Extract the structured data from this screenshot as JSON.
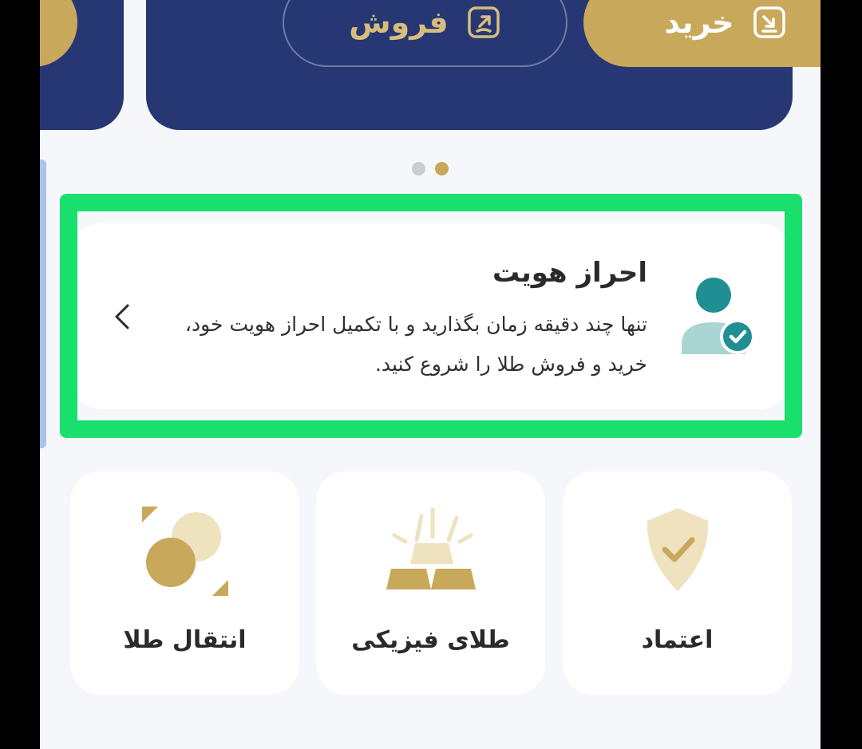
{
  "hero": {
    "buy_label": "خرید",
    "sell_label": "فروش",
    "navy_color": "#263773",
    "gold_color": "#c8a85a"
  },
  "carousel": {
    "active_index": 1,
    "count": 2
  },
  "kyc": {
    "title": "احراز هویت",
    "description": "تنها چند دقیقه زمان بگذارید و با تکمیل احراز هویت خود، خرید و فروش طلا را شروع کنید."
  },
  "features": [
    {
      "label": "اعتماد",
      "icon": "shield-check-icon"
    },
    {
      "label": "طلای فیزیکی",
      "icon": "gold-bars-icon"
    },
    {
      "label": "انتقال طلا",
      "icon": "transfer-coins-icon"
    }
  ],
  "highlight_color": "#19e06c"
}
